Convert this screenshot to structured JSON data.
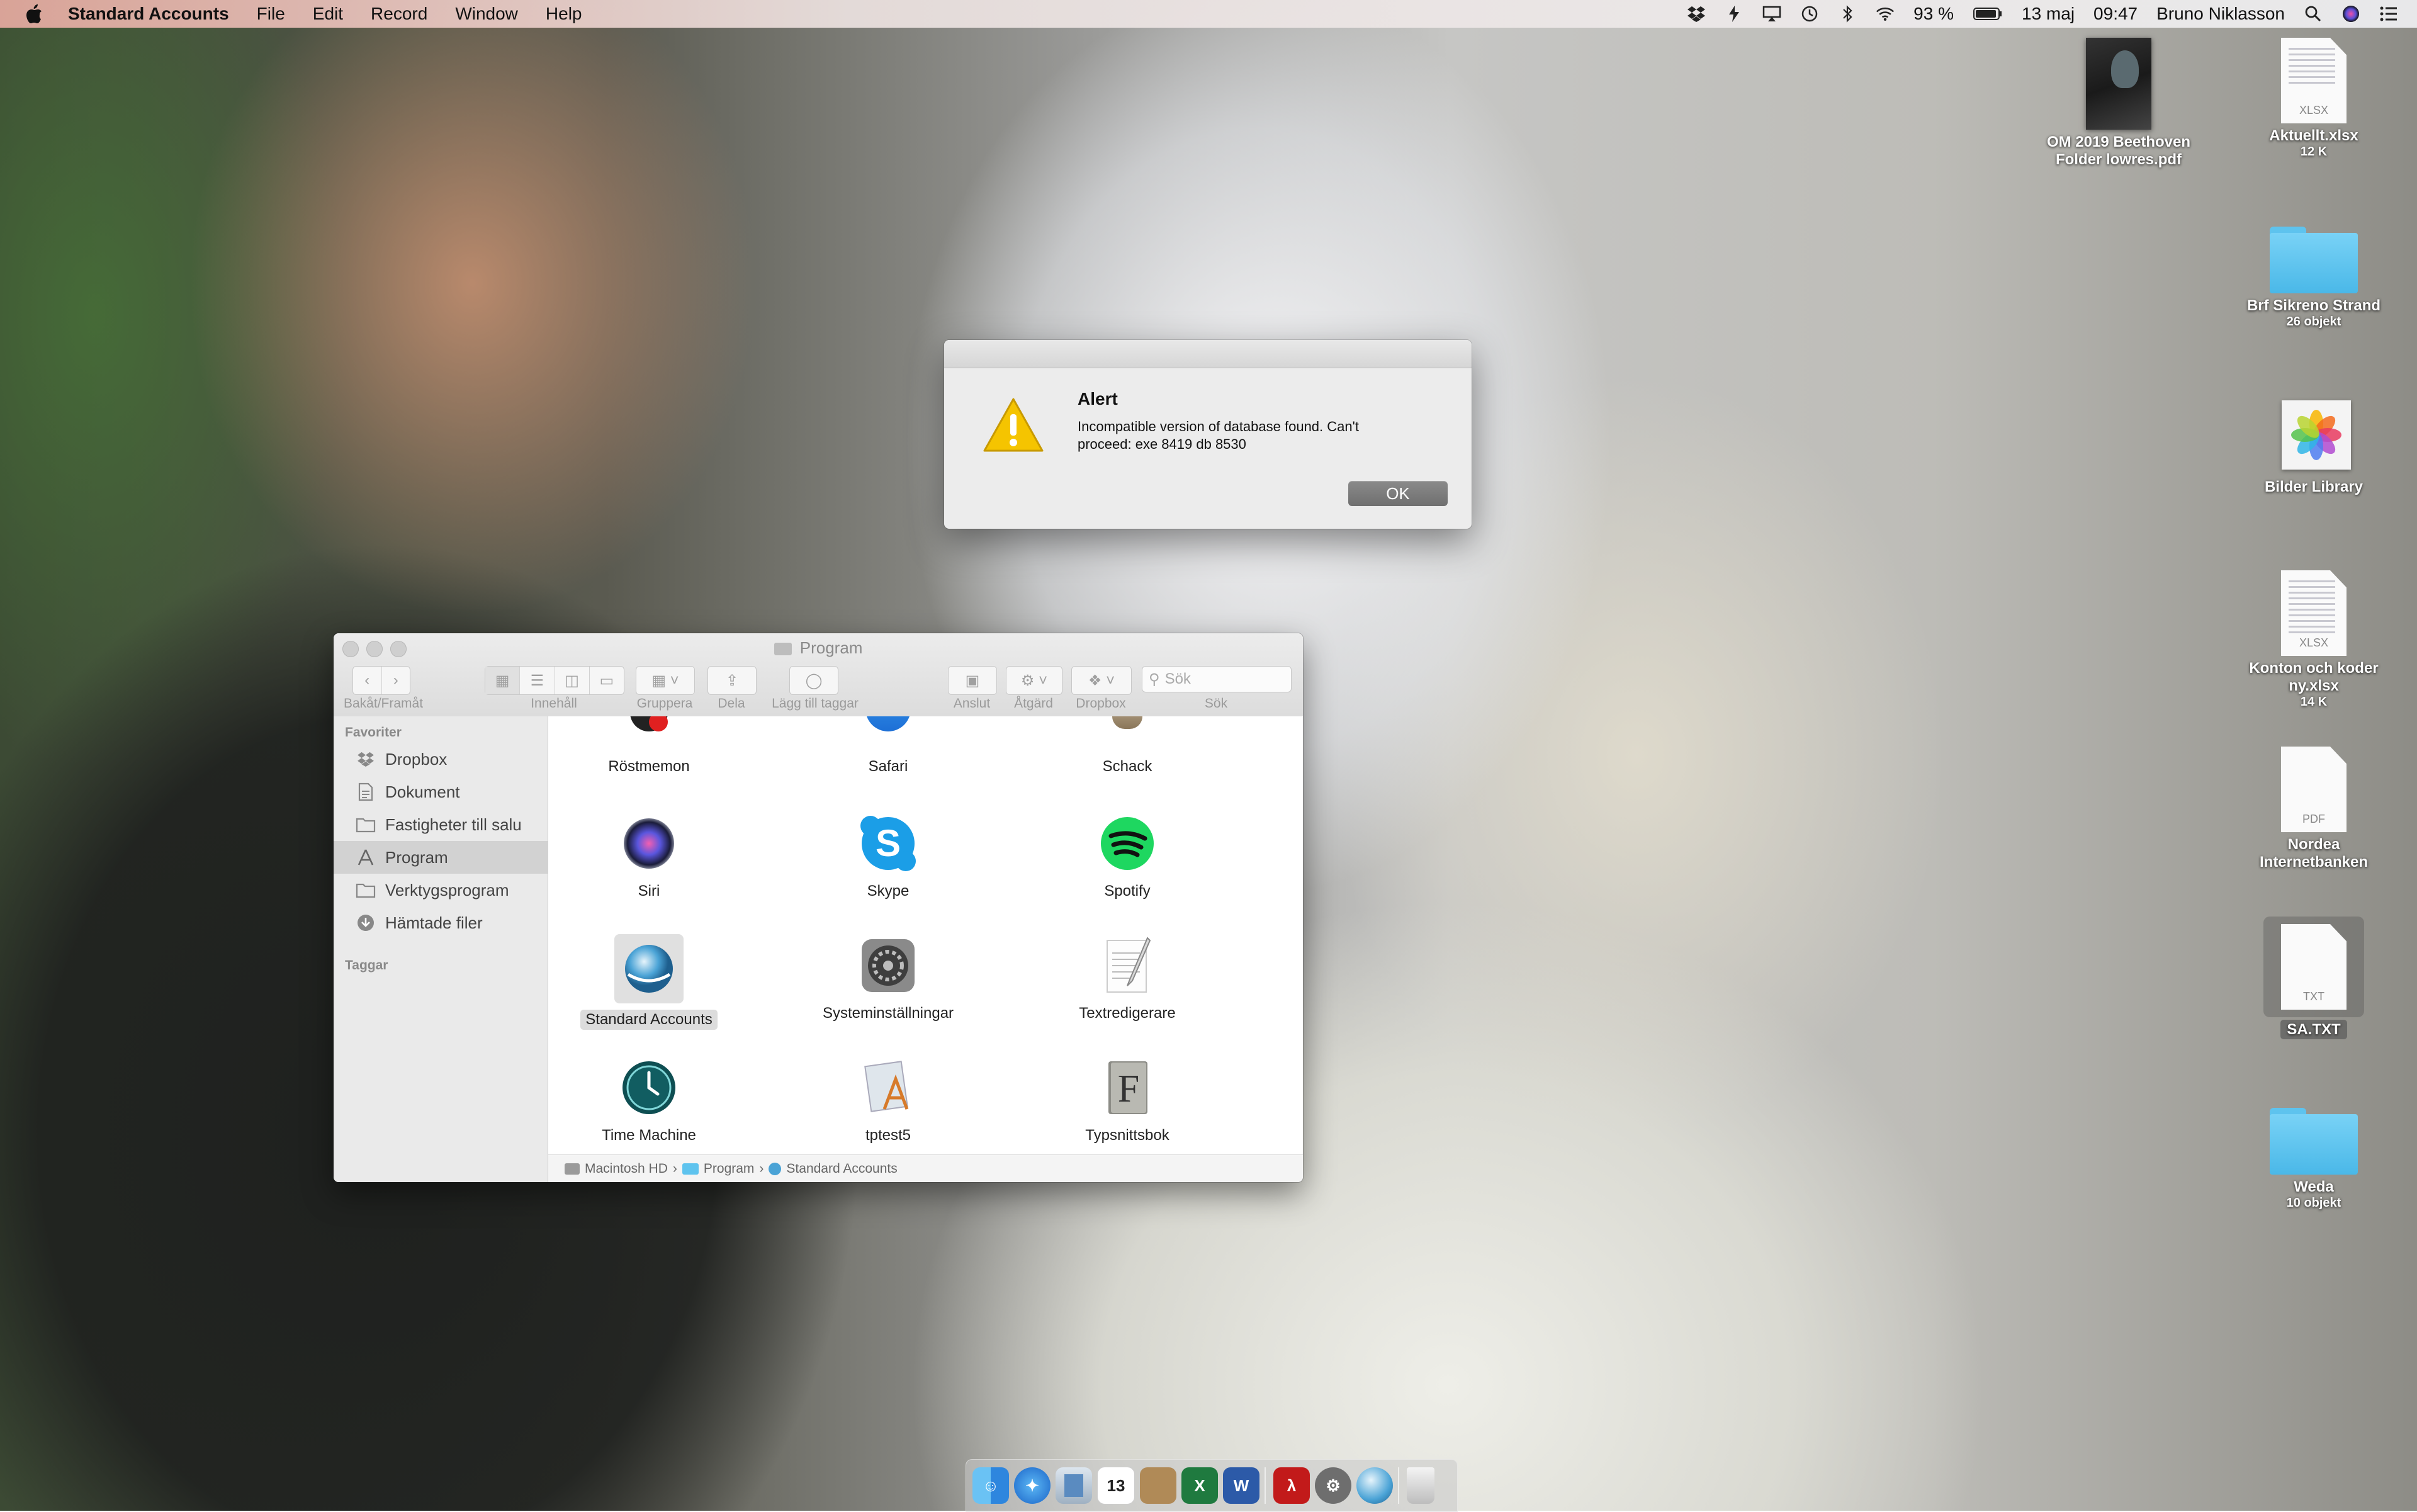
{
  "menubar": {
    "app_name": "Standard Accounts",
    "menus": [
      "File",
      "Edit",
      "Record",
      "Window",
      "Help"
    ],
    "battery": "93 %",
    "date": "13 maj",
    "time": "09:47",
    "user": "Bruno Niklasson"
  },
  "desktop": {
    "items": [
      {
        "name": "OM 2019 Beethoven Folder lowres.pdf",
        "sub": ""
      },
      {
        "name": "Aktuellt.xlsx",
        "sub": "12 K",
        "ext": "XLSX"
      },
      {
        "name": "Brf Sikreno Strand",
        "sub": "26 objekt"
      },
      {
        "name": "Bilder Library",
        "sub": ""
      },
      {
        "name": "Konton och koder ny.xlsx",
        "sub": "14 K",
        "ext": "XLSX"
      },
      {
        "name": "Nordea Internetbanken",
        "sub": "",
        "ext": "PDF"
      },
      {
        "name": "SA.TXT",
        "sub": "",
        "ext": "TXT"
      },
      {
        "name": "Weda",
        "sub": "10 objekt"
      }
    ]
  },
  "alert": {
    "title": "Alert",
    "message": "Incompatible version of database found. Can't proceed: exe 8419 db 8530",
    "ok": "OK"
  },
  "finder": {
    "title": "Program",
    "toolbar": {
      "nav": "Bakåt/Framåt",
      "view": "Innehåll",
      "group": "Gruppera",
      "share": "Dela",
      "tags": "Lägg till taggar",
      "connect": "Anslut",
      "action": "Åtgärd",
      "dropbox": "Dropbox",
      "search_label": "Sök",
      "search_placeholder": "Sök"
    },
    "sidebar": {
      "favorites_header": "Favoriter",
      "items": [
        "Dropbox",
        "Dokument",
        "Fastigheter till salu",
        "Program",
        "Verktygsprogram",
        "Hämtade filer"
      ],
      "tags_header": "Taggar"
    },
    "apps": [
      "Röstmemon",
      "Safari",
      "Schack",
      "Siri",
      "Skype",
      "Spotify",
      "Standard Accounts",
      "Systeminställningar",
      "Textredigerare",
      "Time Machine",
      "tptest5",
      "Typsnittsbok"
    ],
    "path": [
      "Macintosh HD",
      "Program",
      "Standard Accounts"
    ]
  },
  "dock": {
    "calendar_day": "13"
  },
  "colors": {
    "folder_blue": "#5ec3ee",
    "ok_button": "#7a7a7a",
    "warning_yellow": "#f5c400"
  }
}
